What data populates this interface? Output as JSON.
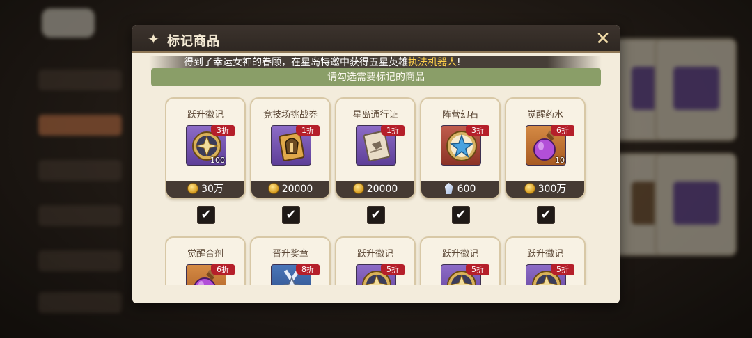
{
  "dialog": {
    "title": "标记商品",
    "close_label": "✕"
  },
  "ticker": {
    "text_before": "得到了幸运女神的眷顾，在星岛特邀中获得五星英雄",
    "highlight": "执法机器人",
    "text_after": "!"
  },
  "hint": "请勾选需要标记的商品",
  "items": [
    {
      "name": "跃升徽记",
      "discount": "3折",
      "qty": "100",
      "price": "30万",
      "currency": "coin-icon",
      "rarity": "purple",
      "icon": "badge-star-icon",
      "checked": true
    },
    {
      "name": "竞技场挑战券",
      "discount": "1折",
      "qty": "",
      "price": "20000",
      "currency": "coin-icon",
      "rarity": "purple",
      "icon": "helmet-ticket-icon",
      "checked": true
    },
    {
      "name": "星岛通行证",
      "discount": "1折",
      "qty": "",
      "price": "20000",
      "currency": "coin-icon",
      "rarity": "purple",
      "icon": "pass-scroll-icon",
      "checked": true
    },
    {
      "name": "阵营幻石",
      "discount": "3折",
      "qty": "",
      "price": "600",
      "currency": "crystal-icon",
      "rarity": "red",
      "icon": "faction-stone-icon",
      "checked": true
    },
    {
      "name": "觉醒药水",
      "discount": "6折",
      "qty": "10",
      "price": "300万",
      "currency": "coin-icon",
      "rarity": "orange",
      "icon": "potion-icon",
      "checked": true
    },
    {
      "name": "觉醒合剂",
      "discount": "6折",
      "qty": "",
      "price": "",
      "currency": "",
      "rarity": "orange",
      "icon": "potion-icon",
      "checked": false
    },
    {
      "name": "晋升奖章",
      "discount": "8折",
      "qty": "",
      "price": "",
      "currency": "",
      "rarity": "blue",
      "icon": "medal-icon",
      "checked": false
    },
    {
      "name": "跃升徽记",
      "discount": "5折",
      "qty": "",
      "price": "",
      "currency": "",
      "rarity": "purple",
      "icon": "badge-star-icon",
      "checked": false
    },
    {
      "name": "跃升徽记",
      "discount": "5折",
      "qty": "",
      "price": "",
      "currency": "",
      "rarity": "purple",
      "icon": "badge-star-icon",
      "checked": false
    },
    {
      "name": "跃升徽记",
      "discount": "5折",
      "qty": "",
      "price": "",
      "currency": "",
      "rarity": "purple",
      "icon": "badge-star-icon",
      "checked": false
    }
  ],
  "check_mark": "✔",
  "colors": {
    "hint_bar": "#8a9e68",
    "discount_tag": "#b51f2a",
    "highlight": "#ffd04a",
    "header": "#2e2722"
  }
}
